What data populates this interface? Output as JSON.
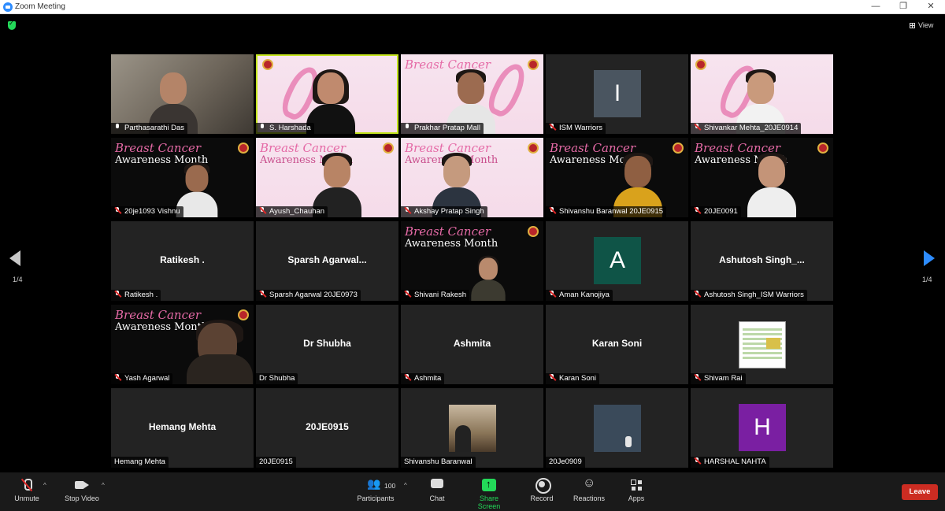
{
  "window": {
    "title": "Zoom Meeting"
  },
  "view_label": "View",
  "page": {
    "left": "1/4",
    "right": "1/4"
  },
  "tiles": [
    {
      "label": "Parthasarathi Das",
      "center": ""
    },
    {
      "label": "S. Harshada",
      "center": ""
    },
    {
      "label": "Prakhar Pratap Mall",
      "center": ""
    },
    {
      "label": "ISM Warriors",
      "center": "",
      "avatar": "I"
    },
    {
      "label": "Shivankar Mehta_20JE0914",
      "center": ""
    },
    {
      "label": "20je1093 Vishnu",
      "center": ""
    },
    {
      "label": "Ayush_Chauhan",
      "center": ""
    },
    {
      "label": "Akshay Pratap Singh",
      "center": ""
    },
    {
      "label": "Shivanshu Baranwal 20JE0915",
      "center": ""
    },
    {
      "label": "20JE0091",
      "center": ""
    },
    {
      "label": "Ratikesh .",
      "center": "Ratikesh ."
    },
    {
      "label": "Sparsh Agarwal 20JE0973",
      "center": "Sparsh  Agarwal..."
    },
    {
      "label": "Shivani Rakesh",
      "center": ""
    },
    {
      "label": "Aman Kanojiya",
      "center": "",
      "avatar": "A"
    },
    {
      "label": "Ashutosh Singh_ISM Warriors",
      "center": "Ashutosh  Singh_..."
    },
    {
      "label": "Yash Agarwal",
      "center": ""
    },
    {
      "label": "Dr Shubha",
      "center": "Dr Shubha"
    },
    {
      "label": "Ashmita",
      "center": "Ashmita"
    },
    {
      "label": "Karan Soni",
      "center": "Karan Soni"
    },
    {
      "label": "Shivam Rai",
      "center": ""
    },
    {
      "label": "Hemang Mehta",
      "center": "Hemang Mehta"
    },
    {
      "label": "20JE0915",
      "center": "20JE0915"
    },
    {
      "label": "Shivanshu Baranwal",
      "center": ""
    },
    {
      "label": "20Je0909",
      "center": ""
    },
    {
      "label": "HARSHAL NAHTA",
      "center": "",
      "avatar": "H"
    }
  ],
  "banner": {
    "line1": "Breast Cancer",
    "line2": "Awareness Month"
  },
  "toolbar": {
    "unmute": "Unmute",
    "stop_video": "Stop Video",
    "participants": "Participants",
    "participant_count": "100",
    "chat": "Chat",
    "share_screen": "Share Screen",
    "record": "Record",
    "reactions": "Reactions",
    "apps": "Apps",
    "leave": "Leave"
  },
  "colors": {
    "active_speaker": "#c5e51f",
    "share_green": "#23d959",
    "leave_red": "#cc2c22",
    "next_arrow": "#2d8cff",
    "avatar_I": "#4a5560",
    "avatar_A": "#0f5447",
    "avatar_H": "#7a1fa2"
  }
}
